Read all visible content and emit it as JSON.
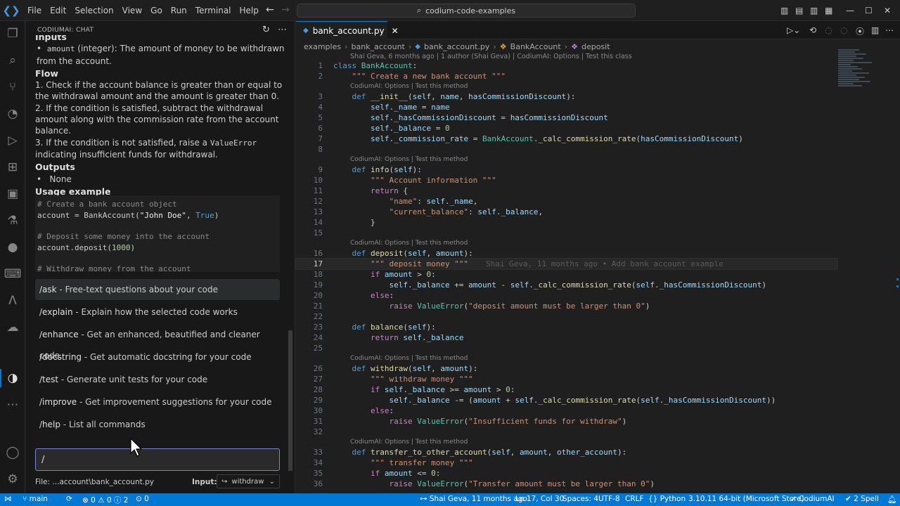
{
  "titlebar": {
    "menu": [
      "File",
      "Edit",
      "Selection",
      "View",
      "Go",
      "Run",
      "Terminal",
      "Help"
    ],
    "command_center": "codium-code-examples"
  },
  "chat": {
    "header_title": "CODIUMAI: CHAT",
    "content": {
      "inputs_heading": "Inputs",
      "input_param_code": "amount",
      "input_param_desc": " (integer): The amount of money to be withdrawn from the account.",
      "flow_heading": "Flow",
      "flow_1": "1. Check if the account balance is greater than or equal to the withdrawal amount and the amount is greater than 0.",
      "flow_2": "2. If the condition is satisfied, subtract the withdrawal amount along with the commission rate from the account balance.",
      "flow_3_pre": "3. If the condition is not satisfied, raise a ",
      "flow_3_code": "ValueError",
      "flow_3_post": " indicating insufficient funds for withdrawal.",
      "outputs_heading": "Outputs",
      "outputs_item": "None",
      "usage_heading": "Usage example",
      "code_comment_1": "# Create a bank account object",
      "code_line_1_pre": "account = BankAccount(",
      "code_line_1_str": "\"John Doe\"",
      "code_line_1_sep": ", ",
      "code_line_1_true": "True",
      "code_line_1_post": ")",
      "code_comment_2": "# Deposit some money into the account",
      "code_line_2_pre": "account.deposit(",
      "code_line_2_num": "1000",
      "code_line_2_post": ")",
      "code_comment_3": "# Withdraw money from the account"
    },
    "commands": [
      {
        "name": "/ask",
        "desc": " - Free-text questions about your code"
      },
      {
        "name": "/explain",
        "desc": " - Explain how the selected code works"
      },
      {
        "name": "/enhance",
        "desc": " - Get an enhanced, beautified and cleaner code."
      },
      {
        "name": "/docstring",
        "desc": " - Get automatic docstring for your code"
      },
      {
        "name": "/test",
        "desc": " - Generate unit tests for your code"
      },
      {
        "name": "/improve",
        "desc": " - Get improvement suggestions for your code"
      },
      {
        "name": "/help",
        "desc": " - List all commands"
      }
    ],
    "input_value": "/",
    "file_label": "File:  ...account\\bank_account.py",
    "input_label": "Input:",
    "input_select_value": "withdraw"
  },
  "editor": {
    "tab_title": "bank_account.py",
    "breadcrumb": [
      "examples",
      "bank_account",
      "bank_account.py",
      "BankAccount",
      "deposit"
    ],
    "blame_top": "Shai Geva, 6 months ago | 1 author (Shai Geva) | CodiumAI: Options | Test this class",
    "lens_text": "CodiumAI: Options | Test this method",
    "ghost_blame": "Shai Geva, 11 months ago • Add bank account example",
    "line_numbers": [
      "1",
      "2",
      "3",
      "4",
      "5",
      "6",
      "7",
      "8",
      "9",
      "10",
      "11",
      "12",
      "13",
      "14",
      "15",
      "16",
      "17",
      "18",
      "19",
      "20",
      "21",
      "22",
      "23",
      "24",
      "25",
      "26",
      "27",
      "28",
      "29",
      "30",
      "31",
      "32",
      "33",
      "34",
      "35",
      "36"
    ]
  },
  "statusbar": {
    "branch": "main",
    "problems": "0 ⚠ 0 ⓘ 2",
    "ports": "0",
    "blame": "Shai Geva, 11 months ago",
    "cursor": "Ln 17, Col 30",
    "spaces": "Spaces: 4",
    "encoding": "UTF-8",
    "eol": "CRLF",
    "language": "Python",
    "interpreter": "3.10.11 64-bit (Microsoft Store)",
    "codiumai": "CodiumAI",
    "spell": "2 Spell"
  },
  "colors": {
    "accent": "#0078d4",
    "input_border": "#7b7fe0",
    "keyword": "#569cd6",
    "string": "#ce9178",
    "function": "#dcdcaa",
    "class": "#4ec9b0"
  }
}
